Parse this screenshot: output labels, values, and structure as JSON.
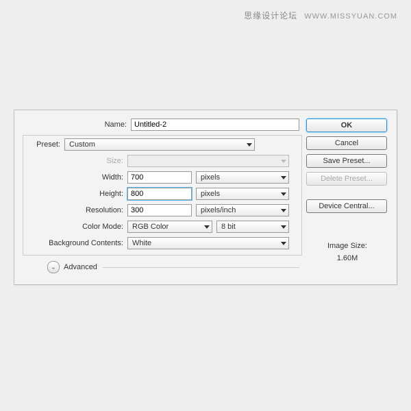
{
  "watermark": {
    "cn": "思缘设计论坛",
    "url": "WWW.MISSYUAN.COM"
  },
  "labels": {
    "name": "Name:",
    "preset": "Preset:",
    "size": "Size:",
    "width": "Width:",
    "height": "Height:",
    "resolution": "Resolution:",
    "colorMode": "Color Mode:",
    "bgContents": "Background Contents:",
    "advanced": "Advanced",
    "imageSize": "Image Size:"
  },
  "values": {
    "name": "Untitled-2",
    "preset": "Custom",
    "size": "",
    "width": "700",
    "widthUnit": "pixels",
    "height": "800",
    "heightUnit": "pixels",
    "resolution": "300",
    "resolutionUnit": "pixels/inch",
    "colorMode": "RGB Color",
    "bitDepth": "8 bit",
    "bgContents": "White",
    "imageSize": "1.60M"
  },
  "buttons": {
    "ok": "OK",
    "cancel": "Cancel",
    "savePreset": "Save Preset...",
    "deletePreset": "Delete Preset...",
    "deviceCentral": "Device Central..."
  }
}
